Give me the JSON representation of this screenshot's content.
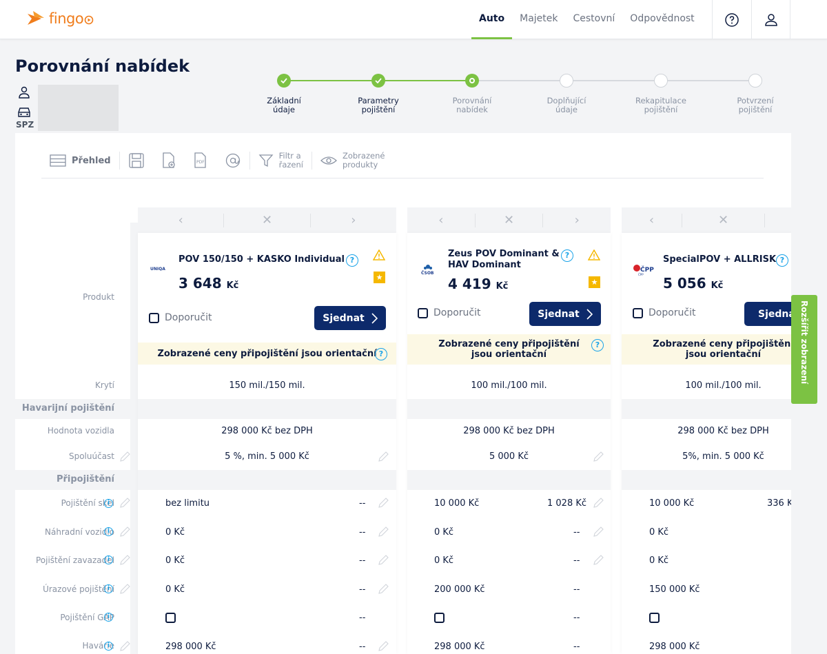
{
  "header": {
    "logo_text": "fingo",
    "nav": [
      "Auto",
      "Majetek",
      "Cestovní",
      "Odpovědnost"
    ],
    "active_nav": "Auto"
  },
  "page": {
    "title": "Porovnání nabídek",
    "spz_label": "SPZ"
  },
  "stepper": {
    "steps": [
      {
        "line1": "Základní",
        "line2": "údaje",
        "state": "done"
      },
      {
        "line1": "Parametry",
        "line2": "pojištění",
        "state": "done"
      },
      {
        "line1": "Porovnání",
        "line2": "nabídek",
        "state": "current"
      },
      {
        "line1": "Doplňující",
        "line2": "údaje",
        "state": "todo"
      },
      {
        "line1": "Rekapitulace",
        "line2": "pojištění",
        "state": "todo"
      },
      {
        "line1": "Potvrzení",
        "line2": "pojištění",
        "state": "todo"
      }
    ]
  },
  "toolbar": {
    "overview": "Přehled",
    "filter_line1": "Filtr a",
    "filter_line2": "řazení",
    "products_line1": "Zobrazené",
    "products_line2": "produkty"
  },
  "labels": {
    "produkt": "Produkt",
    "kryti": "Krytí",
    "section_havarijni": "Havarijní pojištění",
    "hodnota": "Hodnota vozidla",
    "spoluucast": "Spoluúčast",
    "section_pripojisteni": "Připojištění",
    "skla": "Pojištění skel",
    "nahradni": "Náhradní vozidlo",
    "zavazadla": "Pojištění zavazadel",
    "urazove": "Úrazové pojištění",
    "gap": "Pojištění GAP",
    "havarie": "Havárie"
  },
  "common": {
    "doporucit": "Doporučit",
    "sjednat": "Sjednat",
    "dash": "--",
    "banner": "Zobrazené ceny připojištění jsou orientační",
    "expand": "Rozšířit zobrazení"
  },
  "products": [
    {
      "insurer_logo": "UNIQA",
      "name": "POV 150/150 + KASKO Individual",
      "price": "3 648",
      "currency": "Kč",
      "kryti": "150 mil./150 mil.",
      "hodnota": "298 000 Kč bez DPH",
      "spoluucast": "5 %, min. 5 000 Kč",
      "skla": "bez limitu",
      "skla_price": "--",
      "nahradni": "0 Kč",
      "nahradni_price": "--",
      "zavazadla": "0 Kč",
      "zavazadla_price": "--",
      "urazove": "0 Kč",
      "urazove_price": "--",
      "gap_price": "--",
      "havarie": "298 000 Kč",
      "havarie_price": "--"
    },
    {
      "insurer_logo": "ČSOB",
      "name_line1": "Zeus POV Dominant &",
      "name_line2": "HAV Dominant",
      "price": "4 419",
      "currency": "Kč",
      "kryti": "100 mil./100 mil.",
      "hodnota": "298 000 Kč bez DPH",
      "spoluucast": "5 000 Kč",
      "skla": "10 000 Kč",
      "skla_price": "1 028 Kč",
      "nahradni": "0 Kč",
      "nahradni_price": "--",
      "zavazadla": "0 Kč",
      "zavazadla_price": "--",
      "urazove": "200 000 Kč",
      "urazove_price": "--",
      "gap_price": "--",
      "havarie": "298 000 Kč",
      "havarie_price": "--"
    },
    {
      "insurer_logo": "ČPP",
      "name": "SpecialPOV + ALLRISK",
      "price": "5 056",
      "currency": "Kč",
      "kryti": "100 mil./100 mil.",
      "hodnota": "298 000 Kč bez DPH",
      "spoluucast": "5%, min. 5 000 Kč",
      "skla": "10 000 Kč",
      "skla_price": "336 K",
      "nahradni": "0 Kč",
      "zavazadla": "0 Kč",
      "urazove": "150 000 Kč",
      "havarie": "298 000 Kč"
    }
  ],
  "colors": {
    "brand_orange": "#f07d1c",
    "accent_green": "#7cc243",
    "primary_navy": "#0d2a6b",
    "info_blue": "#1aa3e8",
    "warning_yellow": "#f5b800",
    "banner_bg": "#fcf8e4"
  }
}
